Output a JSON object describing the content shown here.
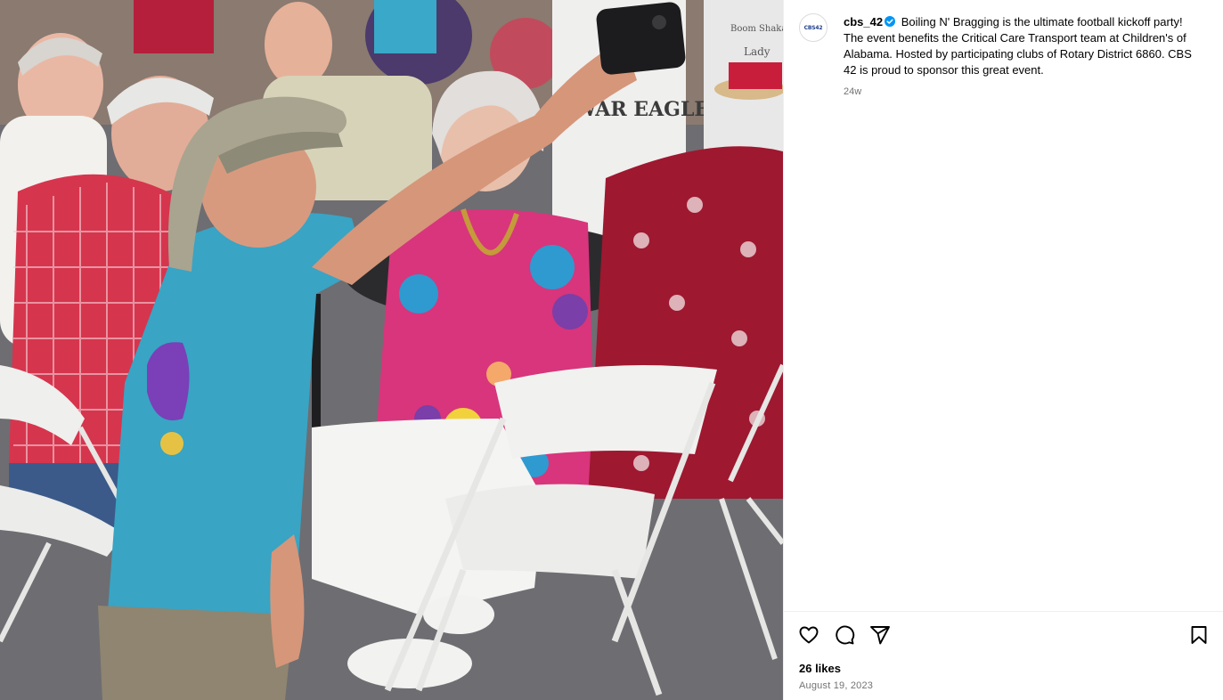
{
  "post": {
    "username": "cbs_42",
    "avatar_text": "CBS42",
    "caption": "Boiling N' Bragging is the ultimate football kickoff party! The event benefits the Critical Care Transport team at Children's of Alabama. Hosted by participating clubs of Rotary District 6860. CBS 42 is proud to sponsor this great event.",
    "relative_time": "24w",
    "likes": "26 likes",
    "date": "August 19, 2023"
  },
  "photo": {
    "shirt_text": "WAR EAGLE",
    "banner_text_1": "Boom Shakalaka",
    "banner_text_2": "Lady"
  },
  "icons": {
    "like": "heart-icon",
    "comment": "comment-icon",
    "share": "send-icon",
    "save": "bookmark-icon",
    "verified": "verified-badge-icon"
  },
  "colors": {
    "verified": "#0095f6",
    "secondary_text": "#737373",
    "divider": "#efefef"
  }
}
